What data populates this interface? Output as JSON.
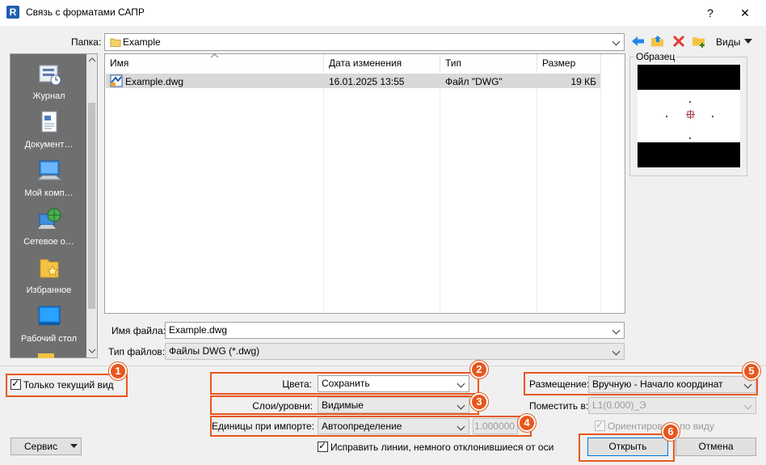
{
  "window": {
    "title": "Связь с форматами САПР",
    "app_icon": "R",
    "help": "?",
    "close": "✕"
  },
  "location": {
    "label": "Папка:",
    "value": "Example",
    "views_label": "Виды"
  },
  "sidebar": {
    "items": [
      {
        "label": "Журнал",
        "icon": "history-icon"
      },
      {
        "label": "Документ…",
        "icon": "documents-icon"
      },
      {
        "label": "Мой комп…",
        "icon": "computer-icon"
      },
      {
        "label": "Сетевое о…",
        "icon": "network-icon"
      },
      {
        "label": "Избранное",
        "icon": "favorites-icon"
      },
      {
        "label": "Рабочий стол",
        "icon": "desktop-icon"
      }
    ]
  },
  "filelist": {
    "columns": [
      "Имя",
      "Дата изменения",
      "Тип",
      "Размер"
    ],
    "rows": [
      {
        "name": "Example.dwg",
        "date": "16.01.2025 13:55",
        "type": "Файл \"DWG\"",
        "size": "19 КБ"
      }
    ]
  },
  "preview": {
    "label": "Образец"
  },
  "filename": {
    "label": "Имя файла:",
    "value": "Example.dwg"
  },
  "filetype": {
    "label": "Тип файлов:",
    "value": "Файлы DWG  (*.dwg)"
  },
  "options": {
    "current_view_only": "Только текущий вид",
    "colors_label": "Цвета:",
    "colors_value": "Сохранить",
    "layers_label": "Слои/уровни:",
    "layers_value": "Видимые",
    "units_label": "Единицы при импорте:",
    "units_value": "Автоопределение",
    "units_factor": "1.000000",
    "fix_lines": "Исправить линии, немного отклонившиеся от оси",
    "placement_label": "Размещение:",
    "placement_value": "Вручную - Начало координат",
    "place_at_label": "Поместить в:",
    "place_at_value": "L1(0.000)_Э",
    "orient_label": "Ориентировать по виду"
  },
  "buttons": {
    "service": "Сервис",
    "open": "Открыть",
    "cancel": "Отмена"
  },
  "badges": [
    "1",
    "2",
    "3",
    "4",
    "5",
    "6"
  ],
  "colors": {
    "accent": "#e8571d",
    "sidebar": "#6f6f6f",
    "selection": "#d9d9d9"
  }
}
